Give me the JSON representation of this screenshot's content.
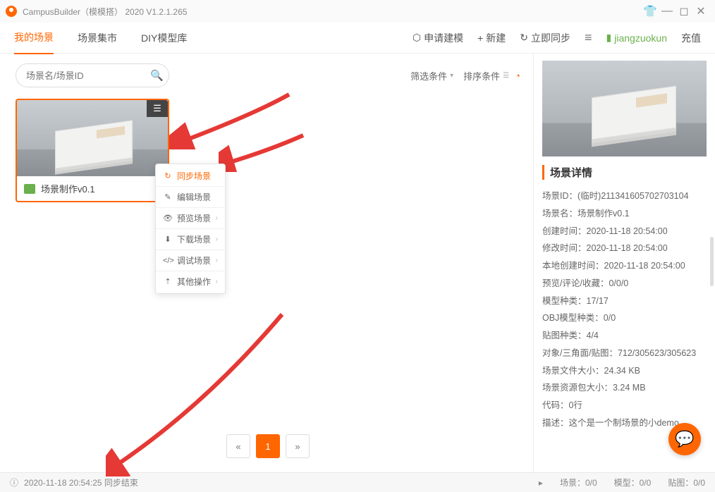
{
  "titlebar": {
    "title": "CampusBuilder（模模搭） 2020  V1.2.1.265"
  },
  "tabs": [
    "我的场景",
    "场景集市",
    "DIY模型库"
  ],
  "topbuttons": {
    "apply": "申请建模",
    "new": "新建",
    "sync": "立即同步",
    "username": "jiangzuokun",
    "recharge": "充值"
  },
  "search": {
    "placeholder": "场景名/场景ID"
  },
  "filters": {
    "filter": "筛选条件",
    "sort": "排序条件"
  },
  "card": {
    "name": "场景制作v0.1"
  },
  "ctxmenu": [
    {
      "label": "同步场景",
      "active": true,
      "icon": "↻",
      "sub": false
    },
    {
      "label": "编辑场景",
      "active": false,
      "icon": "✎",
      "sub": false
    },
    {
      "label": "预览场景",
      "active": false,
      "icon": "👁",
      "sub": true
    },
    {
      "label": "下载场景",
      "active": false,
      "icon": "⬇",
      "sub": true
    },
    {
      "label": "调试场景",
      "active": false,
      "icon": "</>",
      "sub": true
    },
    {
      "label": "其他操作",
      "active": false,
      "icon": "⇡",
      "sub": true
    }
  ],
  "pager": {
    "prev": "«",
    "page": "1",
    "next": "»"
  },
  "details": {
    "heading": "场景详情",
    "items": [
      "场景ID：(临时)211341605702703104",
      "场景名：场景制作v0.1",
      "创建时间：2020-11-18 20:54:00",
      "修改时间：2020-11-18 20:54:00",
      "本地创建时间：2020-11-18 20:54:00",
      "预览/评论/收藏：0/0/0",
      "模型种类：17/17",
      "OBJ模型种类：0/0",
      "贴图种类：4/4",
      "对象/三角面/贴图：712/305623/305623",
      "场景文件大小：24.34 KB",
      "场景资源包大小：3.24 MB",
      "代码：0行",
      "描述：这个是一个制场景的小demo"
    ]
  },
  "status": {
    "time": "2020-11-18 20:54:25 同步结束",
    "scene": "场景：0/0",
    "model": "模型：0/0",
    "texture": "贴图：0/0"
  }
}
